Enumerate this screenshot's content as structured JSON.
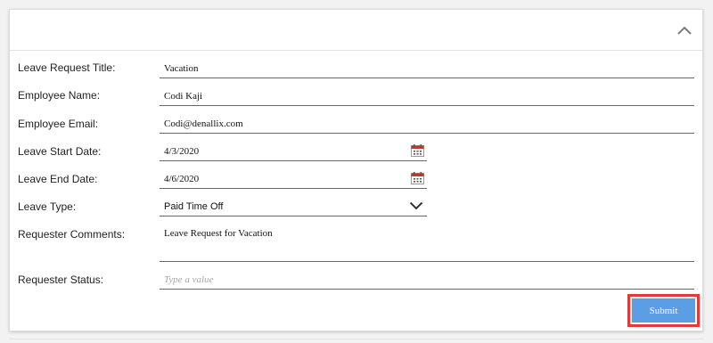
{
  "form": {
    "fields": {
      "title": {
        "label": "Leave Request Title:",
        "value": "Vacation"
      },
      "name": {
        "label": "Employee Name:",
        "value": "Codi Kaji"
      },
      "email": {
        "label": "Employee Email:",
        "value": "Codi@denallix.com"
      },
      "start": {
        "label": "Leave Start Date:",
        "value": "4/3/2020"
      },
      "end": {
        "label": "Leave End Date:",
        "value": "4/6/2020"
      },
      "type": {
        "label": "Leave Type:",
        "value": "Paid Time Off"
      },
      "comments": {
        "label": "Requester Comments:",
        "value": "Leave Request for Vacation"
      },
      "status": {
        "label": "Requester Status:",
        "placeholder": "Type a value"
      }
    },
    "submit_label": "Submit"
  },
  "icons": {
    "collapse": "chevron-up-icon",
    "calendar": "calendar-icon",
    "dropdown": "chevron-down-icon"
  },
  "colors": {
    "accent": "#5b9ee6",
    "highlight": "#e0393e",
    "calendar_red": "#c0392b"
  }
}
